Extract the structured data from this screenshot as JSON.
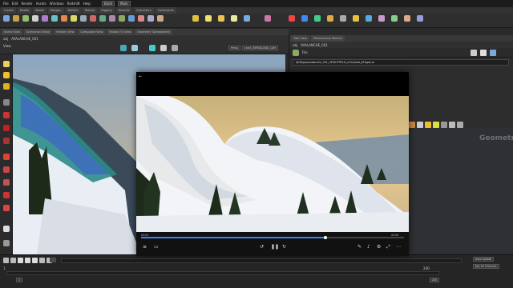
{
  "menubar": [
    "File",
    "Edit",
    "Render",
    "Assets",
    "Windows",
    "Redshift",
    "Help"
  ],
  "build_label": "Build",
  "main_label": "Main",
  "shelf_tabs": [
    "Create",
    "Modify",
    "Model",
    "Polygon",
    "Deform",
    "Texture",
    "Rigging",
    "Muscles",
    "Characters",
    "Constraints"
  ],
  "viewport_tabs": [
    "Scene View",
    "Animation Editor",
    "Render View",
    "Composite View",
    "Motion FX View",
    "Geometry Spreadsheet"
  ],
  "viewport_title": "View",
  "path_obj": "obj",
  "path_node": "AVALANCHE_001",
  "persp": "Persp",
  "cam": "cam1_BERGSLUND_CAM",
  "right_tabs": [
    "Tree View",
    "Performance Monitor"
  ],
  "right_path": "obj",
  "right_node": "AVALANCHE_001",
  "param_field": "File",
  "param_path": "$JOB/geo/avalanche_001_HEIGHTFIELD_v01/vblob_$F.bgeo.sc",
  "net_label": "Geometry",
  "timeline": {
    "frame": "1",
    "start": "1",
    "end": "240",
    "r1": "1",
    "r2": "240"
  },
  "status": [
    "Auto Update",
    "Key All Channels"
  ],
  "player": {
    "time_start": "00:04",
    "time_end": "00:06"
  },
  "progress": 0.7
}
